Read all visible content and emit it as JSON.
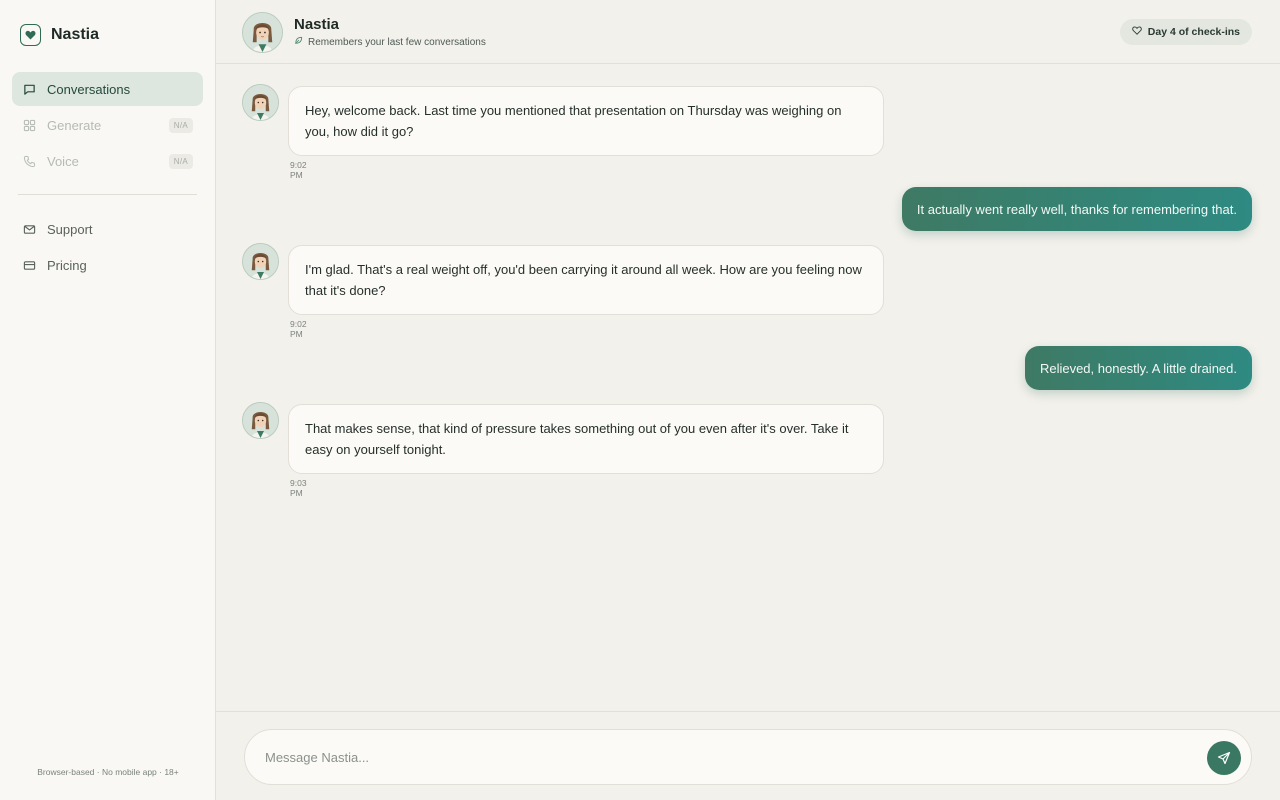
{
  "app": {
    "name": "Nastia"
  },
  "sidebar": {
    "items": [
      {
        "label": "Conversations"
      },
      {
        "label": "Generate",
        "badge": "N/A"
      },
      {
        "label": "Voice",
        "badge": "N/A"
      },
      {
        "label": "Support"
      },
      {
        "label": "Pricing"
      }
    ],
    "footer": "Browser-based · No mobile app · 18+"
  },
  "header": {
    "name": "Nastia",
    "subtitle": "Remembers your last few conversations",
    "day_pill": "Day 4 of check-ins"
  },
  "messages": [
    {
      "from": "bot",
      "text": "Hey, welcome back. Last time you mentioned that presentation on Thursday was weighing on you, how did it go?",
      "time": "9:02 PM"
    },
    {
      "from": "user",
      "text": "It actually went really well, thanks for remembering that."
    },
    {
      "from": "bot",
      "text": "I'm glad. That's a real weight off, you'd been carrying it around all week. How are you feeling now that it's done?",
      "time": "9:02 PM"
    },
    {
      "from": "user",
      "text": "Relieved, honestly. A little drained."
    },
    {
      "from": "bot",
      "text": "That makes sense, that kind of pressure takes something out of you even after it's over. Take it easy on yourself tonight.",
      "time": "9:03 PM"
    }
  ],
  "composer": {
    "placeholder": "Message Nastia..."
  },
  "colors": {
    "accent": "#3a7863",
    "bubble_user_start": "#3e7a64",
    "bubble_user_end": "#2e8a82"
  }
}
